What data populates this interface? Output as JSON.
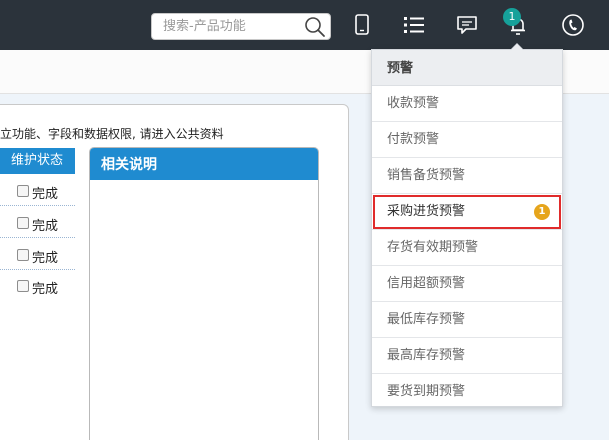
{
  "topbar": {
    "search": {
      "placeholder": "搜索-产品功能"
    },
    "icons": [
      "mobile-icon",
      "list-icon",
      "chat-icon",
      "alert-bell-icon",
      "phone-icon"
    ],
    "notification_badge": "1"
  },
  "main": {
    "notice_text": "立功能、字段和数据权限, 请进入公共资料",
    "status_header": "维护状态",
    "status_rows": [
      "完成",
      "完成",
      "完成",
      "完成"
    ],
    "info_title": "相关说明"
  },
  "alert_menu": {
    "title": "预警",
    "items": [
      {
        "label": "收款预警"
      },
      {
        "label": "付款预警"
      },
      {
        "label": "销售备货预警"
      },
      {
        "label": "采购进货预警",
        "badge": "1",
        "highlighted": true
      },
      {
        "label": "存货有效期预警"
      },
      {
        "label": "信用超额预警"
      },
      {
        "label": "最低库存预警"
      },
      {
        "label": "最高库存预警"
      },
      {
        "label": "要货到期预警"
      }
    ]
  },
  "colors": {
    "topbar": "#2b333b",
    "accent_blue": "#1f8bd0",
    "badge_teal": "#16a19a",
    "badge_orange": "#e6a51c",
    "highlight_red": "#e02b2b"
  }
}
